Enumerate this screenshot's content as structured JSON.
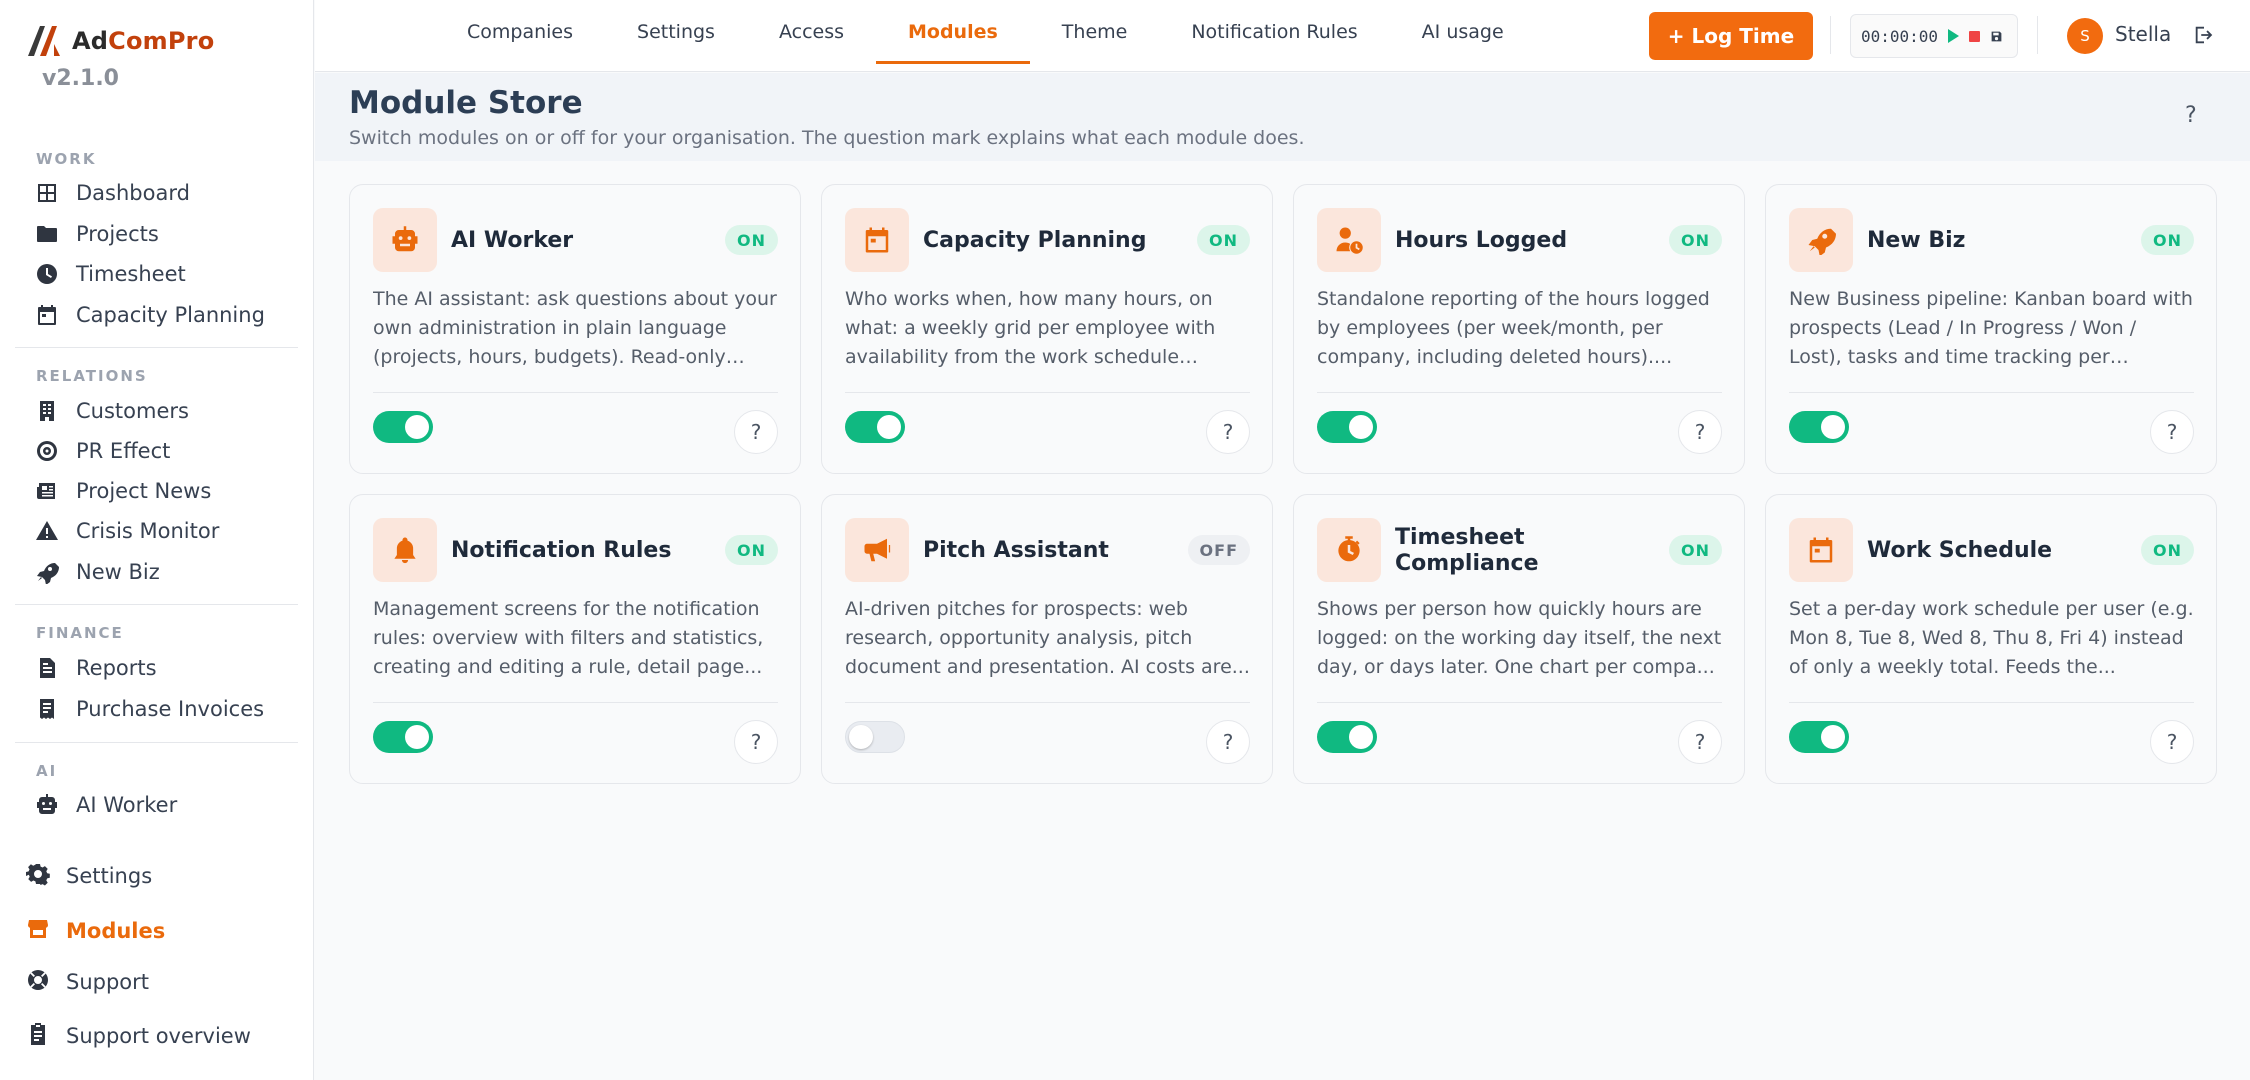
{
  "brand": {
    "name_prefix": "Ad",
    "name_accent": "ComPro",
    "version": "v2.1.0"
  },
  "sidebar": {
    "sections": [
      {
        "label": "WORK",
        "items": [
          {
            "label": "Dashboard",
            "icon": "grid-icon"
          },
          {
            "label": "Projects",
            "icon": "folder-icon"
          },
          {
            "label": "Timesheet",
            "icon": "clock-icon"
          },
          {
            "label": "Capacity Planning",
            "icon": "calendar-icon"
          }
        ]
      },
      {
        "label": "RELATIONS",
        "items": [
          {
            "label": "Customers",
            "icon": "building-icon"
          },
          {
            "label": "PR Effect",
            "icon": "target-icon"
          },
          {
            "label": "Project News",
            "icon": "newspaper-icon"
          },
          {
            "label": "Crisis Monitor",
            "icon": "warning-icon"
          },
          {
            "label": "New Biz",
            "icon": "rocket-icon"
          }
        ]
      },
      {
        "label": "FINANCE",
        "items": [
          {
            "label": "Reports",
            "icon": "file-icon"
          },
          {
            "label": "Purchase Invoices",
            "icon": "invoice-icon"
          }
        ]
      },
      {
        "label": "AI",
        "items": [
          {
            "label": "AI Worker",
            "icon": "robot-icon"
          }
        ]
      }
    ],
    "bottom": [
      {
        "label": "Settings",
        "icon": "gear-icon"
      },
      {
        "label": "Modules",
        "icon": "store-icon",
        "active": true
      },
      {
        "label": "Support",
        "icon": "lifering-icon"
      },
      {
        "label": "Support overview",
        "icon": "clipboard-icon"
      }
    ]
  },
  "topbar": {
    "tabs": [
      "Companies",
      "Settings",
      "Access",
      "Modules",
      "Theme",
      "Notification Rules",
      "AI usage"
    ],
    "active_tab": "Modules",
    "log_time_label": "+ Log Time",
    "timer": "00:00:00",
    "user_initial": "S",
    "user_name": "Stella"
  },
  "header": {
    "title": "Module Store",
    "subtitle": "Switch modules on or off for your organisation. The question mark explains what each module does.",
    "help": "?"
  },
  "modules": [
    {
      "title": "AI Worker",
      "status": "ON",
      "enabled": true,
      "icon": "robot-icon",
      "description": "The AI assistant: ask questions about your own administration in plain language (projects, hours, budgets). Read-only and..."
    },
    {
      "title": "Capacity Planning",
      "status": "ON",
      "enabled": true,
      "icon": "calendar-icon",
      "description": "Who works when, how many hours, on what: a weekly grid per employee with availability from the work schedule minus..."
    },
    {
      "title": "Hours Logged",
      "status": "ON",
      "enabled": true,
      "icon": "user-clock-icon",
      "description": "Standalone reporting of the hours logged by employees (per week/month, per company, including deleted hours)...."
    },
    {
      "title": "New Biz",
      "status": "ON",
      "enabled": true,
      "icon": "rocket-icon",
      "description": "New Business pipeline: Kanban board with prospects (Lead / In Progress / Won / Lost), tasks and time tracking per prospect, and..."
    },
    {
      "title": "Notification Rules",
      "status": "ON",
      "enabled": true,
      "icon": "bell-icon",
      "description": "Management screens for the notification rules: overview with filters and statistics, creating and editing a rule, detail page..."
    },
    {
      "title": "Pitch Assistant",
      "status": "OFF",
      "enabled": false,
      "icon": "megaphone-icon",
      "description": "AI-driven pitches for prospects: web research, opportunity analysis, pitch document and presentation. AI costs are..."
    },
    {
      "title": "Timesheet Compliance",
      "status": "ON",
      "enabled": true,
      "icon": "stopwatch-icon",
      "description": "Shows per person how quickly hours are logged: on the working day itself, the next day, or days later. One chart per compa..."
    },
    {
      "title": "Work Schedule",
      "status": "ON",
      "enabled": true,
      "icon": "calendar-icon",
      "description": "Set a per-day work schedule per user (e.g. Mon 8, Tue 8, Wed 8, Thu 8, Fri 4) instead of only a weekly total. Feeds the..."
    }
  ],
  "colors": {
    "accent": "#ea6a0c",
    "on": "#10b981",
    "badge_on_bg": "#dcf5ea"
  }
}
